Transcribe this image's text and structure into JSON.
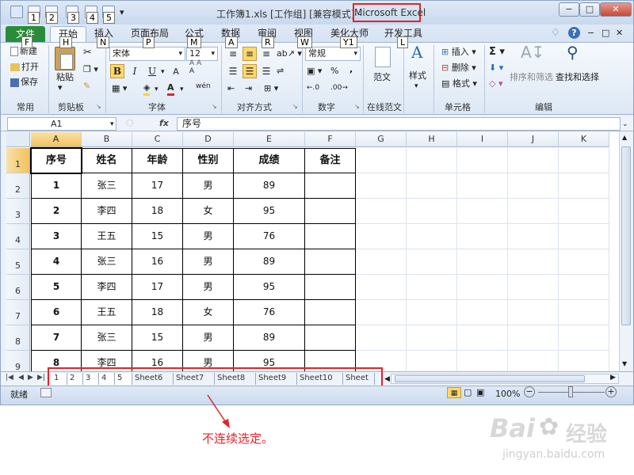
{
  "window": {
    "title_file": "工作簿1.xls  [工作组]  [兼容模式]  -",
    "title_app": "Microsoft Excel",
    "controls": {
      "minimize": "−",
      "maximize": "□",
      "close": "✕"
    }
  },
  "keytips": {
    "f": "F",
    "h": "H",
    "n": "N",
    "p": "P",
    "m": "M",
    "a": "A",
    "r": "R",
    "w": "W",
    "y1": "Y1",
    "l": "L",
    "q1": "1",
    "q2": "2",
    "q3": "3",
    "q4": "4",
    "q5": "5"
  },
  "ribbon": {
    "tabs": [
      "文件",
      "开始",
      "插入",
      "页面布局",
      "公式",
      "数据",
      "审阅",
      "视图",
      "美化大师",
      "开发工具"
    ],
    "groups": {
      "clipboard": {
        "label": "剪贴板",
        "paste": "粘贴",
        "new": "新建",
        "open": "打开",
        "save": "保存",
        "common": "常用"
      },
      "font": {
        "label": "字体",
        "font_name": "宋体",
        "font_size": "12",
        "bold": "B",
        "italic": "I",
        "underline": "U",
        "font_color": "A",
        "phonetic": "wén"
      },
      "alignment": {
        "label": "对齐方式"
      },
      "number": {
        "label": "数字",
        "format": "常规",
        "percent": "%",
        "comma": ","
      },
      "template": {
        "label": "在线范文",
        "button": "范文"
      },
      "styles": {
        "label": "",
        "button": "样式"
      },
      "cells": {
        "label": "单元格",
        "insert": "插入",
        "delete": "删除",
        "format": "格式"
      },
      "editing": {
        "label": "编辑",
        "sort": "排序和筛选",
        "find": "查找和选择"
      }
    }
  },
  "formula_bar": {
    "name_box": "A1",
    "fx": "fx",
    "value": "序号"
  },
  "grid": {
    "columns": [
      "A",
      "B",
      "C",
      "D",
      "E",
      "F",
      "G",
      "H",
      "I",
      "J",
      "K"
    ],
    "row_numbers": [
      "1",
      "2",
      "3",
      "4",
      "5",
      "6",
      "7",
      "8",
      "9"
    ],
    "header_row": [
      "序号",
      "姓名",
      "年龄",
      "性别",
      "成绩",
      "备注"
    ],
    "rows": [
      [
        "1",
        "张三",
        "17",
        "男",
        "89",
        ""
      ],
      [
        "2",
        "李四",
        "18",
        "女",
        "95",
        ""
      ],
      [
        "3",
        "王五",
        "15",
        "男",
        "76",
        ""
      ],
      [
        "4",
        "张三",
        "16",
        "男",
        "89",
        ""
      ],
      [
        "5",
        "李四",
        "17",
        "男",
        "95",
        ""
      ],
      [
        "6",
        "王五",
        "18",
        "女",
        "76",
        ""
      ],
      [
        "7",
        "张三",
        "15",
        "男",
        "89",
        ""
      ],
      [
        "8",
        "李四",
        "16",
        "男",
        "95",
        ""
      ]
    ]
  },
  "sheet_tabs": [
    "1",
    "2",
    "3",
    "4",
    "5",
    "Sheet6",
    "Sheet7",
    "Sheet8",
    "Sheet9",
    "Sheet10",
    "Sheet"
  ],
  "statusbar": {
    "ready": "就绪",
    "zoom": "100%",
    "zoom_out": "−",
    "zoom_in": "+"
  },
  "caption": "不连续选定。",
  "watermark": {
    "brand": "Bai",
    "brand2": "经验",
    "url": "jingyan.baidu.com"
  },
  "colors": {
    "excel_green": "#2a8c3a",
    "highlight_red": "#e0242b",
    "selection_gold": "#f2c25e",
    "ribbon_blue": "#dfe9f6"
  }
}
